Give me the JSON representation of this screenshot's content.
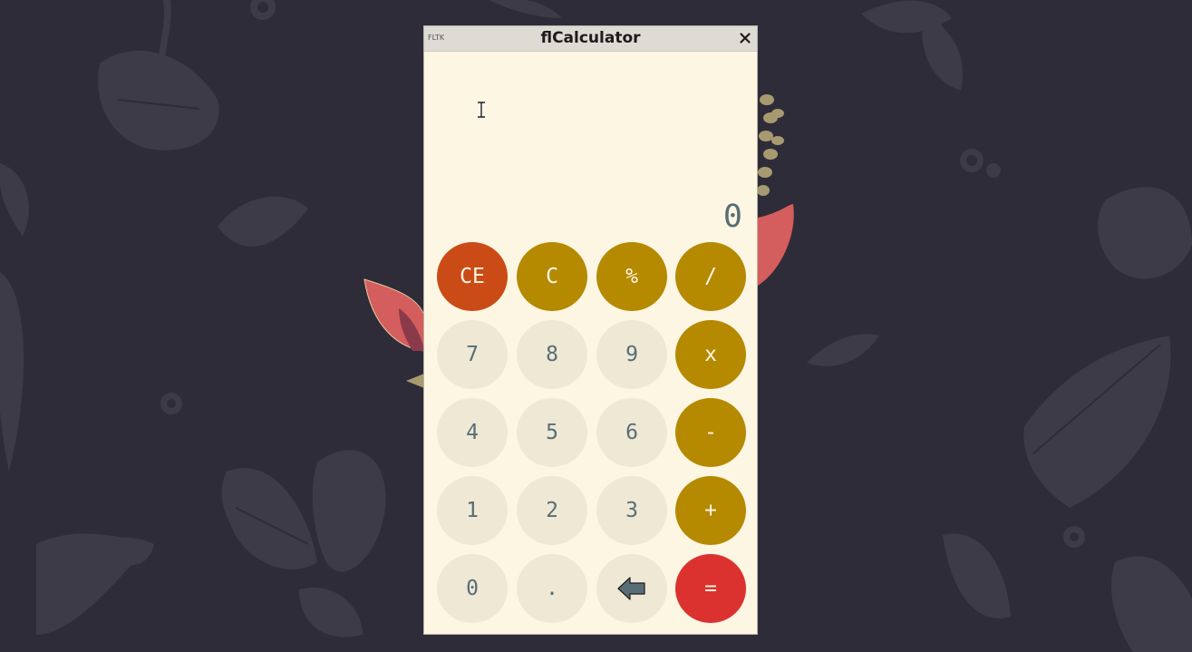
{
  "window": {
    "title": "flCalculator",
    "app_logo_text": "FLTK",
    "close_glyph": "×"
  },
  "display": {
    "value": "0"
  },
  "keys": {
    "ce": "CE",
    "clear": "C",
    "percent": "%",
    "divide": "/",
    "seven": "7",
    "eight": "8",
    "nine": "9",
    "multiply": "x",
    "four": "4",
    "five": "5",
    "six": "6",
    "minus": "-",
    "one": "1",
    "two": "2",
    "three": "3",
    "plus": "+",
    "zero": "0",
    "dot": ".",
    "backspace_icon": "left-arrow-icon",
    "equals": "="
  },
  "colors": {
    "desktop_bg": "#2e2c38",
    "window_bg": "#fdf6e3",
    "number_key": "#eee8d5",
    "operator_key": "#b58900",
    "ce_key": "#cb4b16",
    "equals_key": "#dc322f",
    "text": "#586e75"
  }
}
